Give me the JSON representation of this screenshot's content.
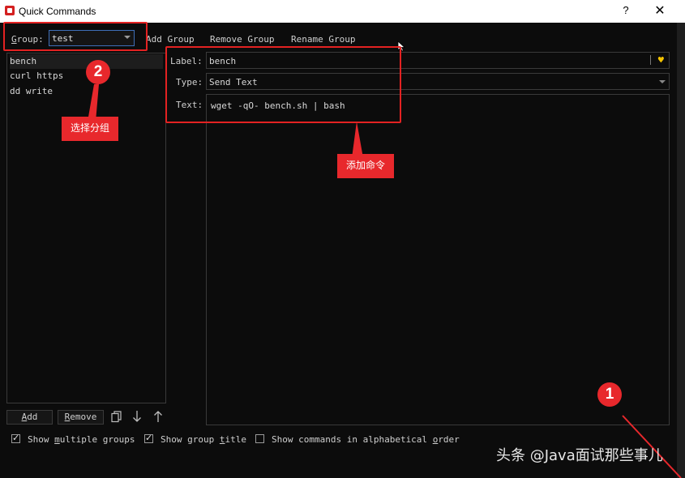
{
  "window": {
    "title": "Quick Commands",
    "help": "?",
    "close": "✕"
  },
  "toolbar": {
    "group_label_pre": "",
    "group_label_ul": "G",
    "group_label_rest": "roup:",
    "group_value": "test",
    "add_group": "Add Group",
    "remove_group": "Remove Group",
    "rename_group": "Rename Group"
  },
  "commands": [
    {
      "label": "bench",
      "selected": true
    },
    {
      "label": "curl https",
      "selected": false
    },
    {
      "label": "dd write",
      "selected": false
    }
  ],
  "form": {
    "label_caption": "Label:",
    "label_value": "bench",
    "type_caption": "Type:",
    "type_value": "Send Text",
    "text_caption": "Text:",
    "text_value": "wget -qO- bench.sh | bash"
  },
  "buttons": {
    "add_ul": "A",
    "add_rest": "dd",
    "remove_ul": "R",
    "remove_rest": "emove"
  },
  "options": {
    "opt1_pre": "Show ",
    "opt1_ul": "m",
    "opt1_post": "ultiple groups",
    "opt2_pre": "Show group ",
    "opt2_ul": "t",
    "opt2_post": "itle",
    "opt3_pre": "Show commands in alphabetical ",
    "opt3_ul": "o",
    "opt3_post": "rder"
  },
  "annotations": {
    "badge1": "1",
    "badge2": "2",
    "select_group": "选择分组",
    "add_command": "添加命令"
  },
  "watermark": "头条 @Java面试那些事儿",
  "colors": {
    "accent_red": "#e8282c",
    "favorite_yellow": "#f5c400",
    "focus_blue": "#3f6fb8"
  }
}
